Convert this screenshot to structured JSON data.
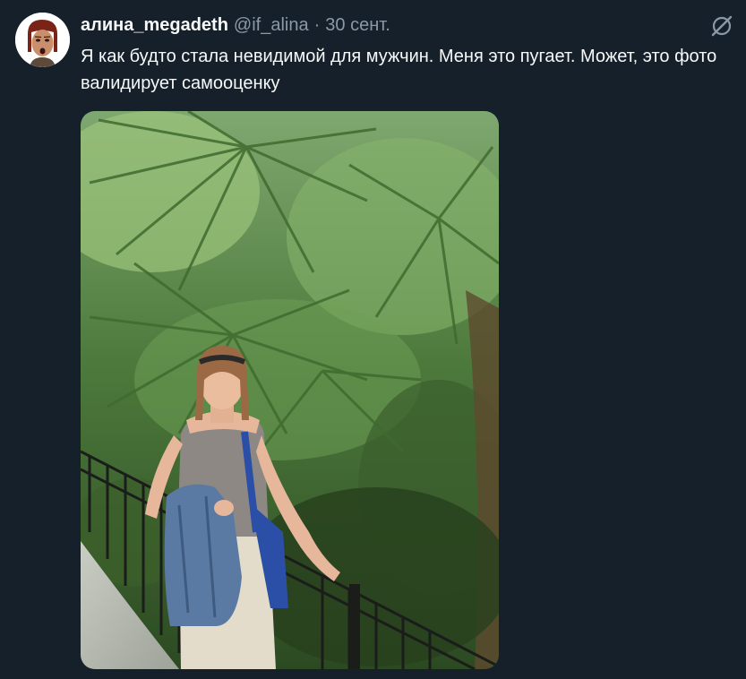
{
  "tweet": {
    "display_name": "алина_megadeth",
    "handle": "@if_alina",
    "separator": "·",
    "date": "30 сент.",
    "text": "Я как будто стала невидимой для мужчин. Меня это пугает. Может, это фото валидирует самооценку",
    "media_type": "photo"
  },
  "icons": {
    "avatar": "avatar-icon",
    "grok": "grok-icon"
  },
  "colors": {
    "background": "#15202b",
    "text_primary": "#f7f9f9",
    "text_secondary": "#8b98a5"
  }
}
